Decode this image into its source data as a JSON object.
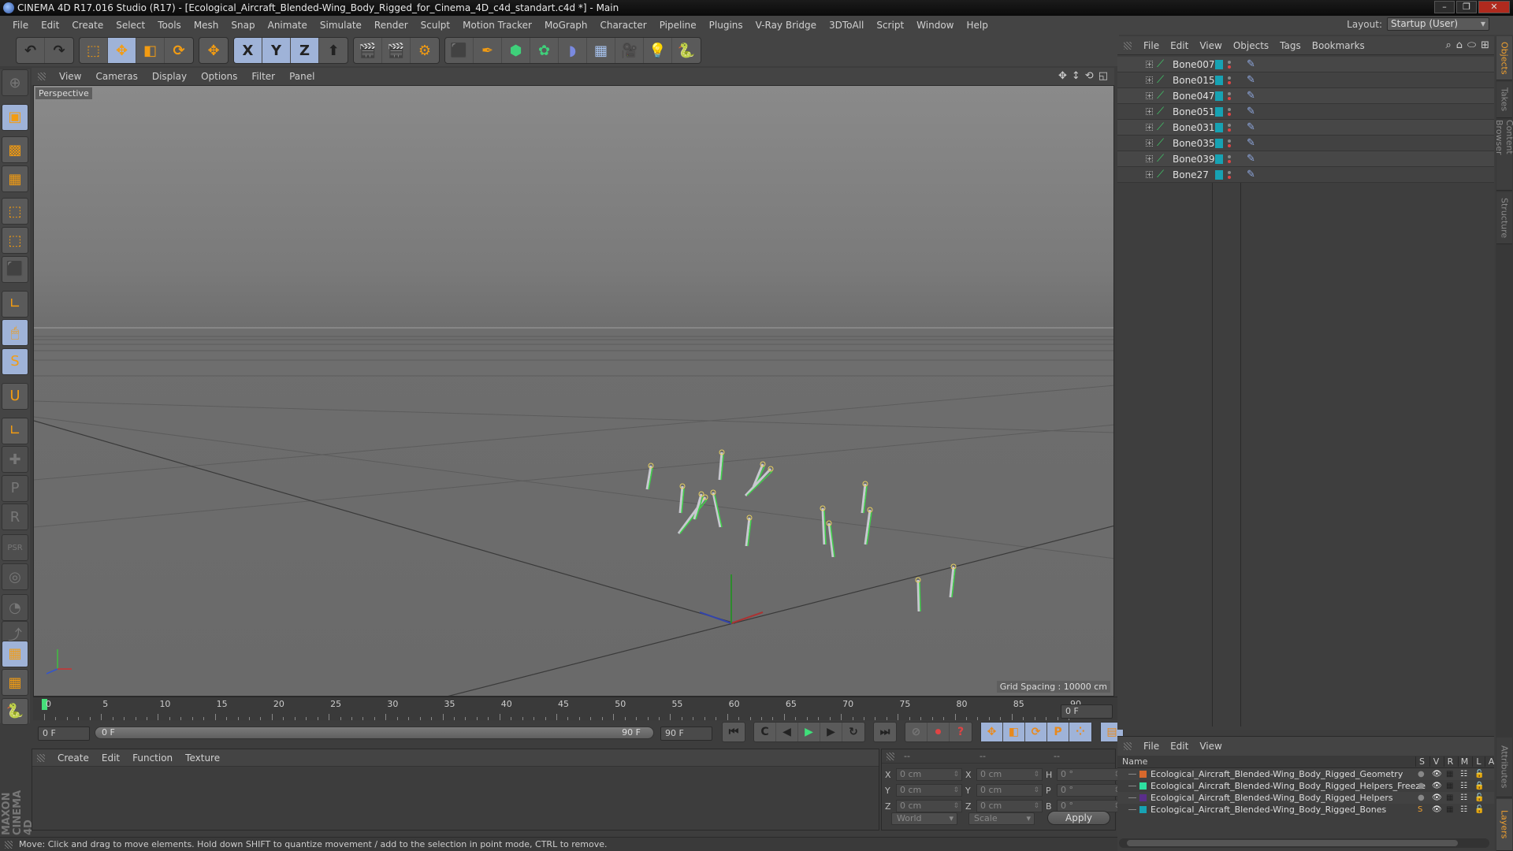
{
  "window": {
    "title": "CINEMA 4D R17.016 Studio (R17) - [Ecological_Aircraft_Blended-Wing_Body_Rigged_for_Cinema_4D_c4d_standart.c4d *] - Main",
    "controls": [
      "minimize",
      "maximize",
      "close"
    ]
  },
  "menubar": {
    "items": [
      "File",
      "Edit",
      "Create",
      "Select",
      "Tools",
      "Mesh",
      "Snap",
      "Animate",
      "Simulate",
      "Render",
      "Sculpt",
      "Motion Tracker",
      "MoGraph",
      "Character",
      "Pipeline",
      "Plugins",
      "V-Ray Bridge",
      "3DToAll",
      "Script",
      "Window",
      "Help"
    ],
    "layout_label": "Layout:",
    "layout_value": "Startup (User)"
  },
  "toolbar": {
    "groups": [
      {
        "name": "history",
        "tools": [
          {
            "id": "undo",
            "icon": "undo-icon",
            "glyph": "↶"
          },
          {
            "id": "redo",
            "icon": "redo-icon",
            "glyph": "↷"
          }
        ]
      },
      {
        "name": "transform",
        "tools": [
          {
            "id": "live-selection",
            "icon": "selection-icon",
            "glyph": "⬚"
          },
          {
            "id": "move",
            "icon": "move-icon",
            "glyph": "✥",
            "active": true
          },
          {
            "id": "scale",
            "icon": "scale-icon",
            "glyph": "◧"
          },
          {
            "id": "rotate",
            "icon": "rotate-icon",
            "glyph": "⟳"
          }
        ]
      },
      {
        "name": "recent",
        "tools": [
          {
            "id": "recent-tool",
            "icon": "move-icon",
            "glyph": "✥"
          }
        ]
      },
      {
        "name": "axis",
        "tools": [
          {
            "id": "x-axis",
            "icon": "x-axis-icon",
            "glyph": "X",
            "active": true
          },
          {
            "id": "y-axis",
            "icon": "y-axis-icon",
            "glyph": "Y",
            "active": true
          },
          {
            "id": "z-axis",
            "icon": "z-axis-icon",
            "glyph": "Z",
            "active": true
          },
          {
            "id": "coord-system",
            "icon": "coordinate-system-icon",
            "glyph": "⬆"
          }
        ]
      },
      {
        "name": "render",
        "tools": [
          {
            "id": "render-view",
            "icon": "render-view-icon",
            "glyph": "🎬"
          },
          {
            "id": "render-picture-viewer",
            "icon": "render-picture-viewer-icon",
            "glyph": "🎬"
          },
          {
            "id": "render-settings",
            "icon": "render-settings-icon",
            "glyph": "⚙"
          }
        ]
      },
      {
        "name": "create",
        "tools": [
          {
            "id": "cube",
            "icon": "cube-icon",
            "glyph": "⬛"
          },
          {
            "id": "pen",
            "icon": "pen-spline-icon",
            "glyph": "✒"
          },
          {
            "id": "subdivision",
            "icon": "subdivision-surface-icon",
            "glyph": "⬢"
          },
          {
            "id": "cloner",
            "icon": "cloner-icon",
            "glyph": "✿"
          },
          {
            "id": "deformer",
            "icon": "bend-deformer-icon",
            "glyph": "◗"
          },
          {
            "id": "floor",
            "icon": "floor-icon",
            "glyph": "▦"
          },
          {
            "id": "camera",
            "icon": "camera-icon",
            "glyph": "🎥"
          },
          {
            "id": "light",
            "icon": "light-icon",
            "glyph": "💡"
          },
          {
            "id": "python",
            "icon": "python-icon",
            "glyph": "🐍"
          }
        ]
      }
    ]
  },
  "leftbar": {
    "tools": [
      {
        "id": "make-editable",
        "icon": "make-editable-icon",
        "glyph": "⊕",
        "state": "dim"
      },
      {
        "id": "model-mode",
        "icon": "model-mode-icon",
        "glyph": "▣",
        "state": "on"
      },
      {
        "id": "texture-mode",
        "icon": "texture-mode-icon",
        "glyph": "▩"
      },
      {
        "id": "workplane-mode",
        "icon": "workplane-icon",
        "glyph": "▦"
      },
      {
        "id": "points-mode",
        "icon": "points-mode-icon",
        "glyph": "⬚"
      },
      {
        "id": "edges-mode",
        "icon": "edges-mode-icon",
        "glyph": "⬚"
      },
      {
        "id": "polygons-mode",
        "icon": "polygons-mode-icon",
        "glyph": "⬛"
      },
      {
        "id": "axis-mode",
        "icon": "axis-mode-icon",
        "glyph": "∟"
      },
      {
        "id": "tweak-mode",
        "icon": "tweak-mode-icon",
        "glyph": "🖱",
        "state": "on"
      },
      {
        "id": "solo-mode",
        "icon": "solo-icon",
        "glyph": "S",
        "state": "on"
      },
      {
        "id": "snap",
        "icon": "magnet-icon",
        "glyph": "U"
      },
      {
        "id": "axis-lock",
        "icon": "axis-lock-icon",
        "glyph": "∟"
      },
      {
        "id": "ik-add",
        "icon": "ik-add-icon",
        "glyph": "✚",
        "state": "dim"
      },
      {
        "id": "ik-p",
        "icon": "ik-position-icon",
        "glyph": "P",
        "state": "dim"
      },
      {
        "id": "ik-r",
        "icon": "ik-rotation-icon",
        "glyph": "R",
        "state": "dim"
      },
      {
        "id": "ik-psr",
        "icon": "ik-psr-icon",
        "glyph": "PSR",
        "state": "dim"
      },
      {
        "id": "ik-target",
        "icon": "ik-target-icon",
        "glyph": "◎",
        "state": "dim"
      },
      {
        "id": "ik-frame",
        "icon": "ik-frame-icon",
        "glyph": "◔",
        "state": "dim"
      },
      {
        "id": "ik-pose",
        "icon": "ik-pose-icon",
        "glyph": "⤴",
        "state": "dim"
      },
      {
        "id": "workplane-lock",
        "icon": "workplane-lock-icon",
        "glyph": "▦",
        "state": "on"
      },
      {
        "id": "workplane-align",
        "icon": "workplane-align-icon",
        "glyph": "▦"
      },
      {
        "id": "python-script",
        "icon": "python-icon",
        "glyph": "🐍"
      }
    ],
    "brand": "MAXON CINEMA 4D"
  },
  "viewport": {
    "menu": [
      "View",
      "Cameras",
      "Display",
      "Options",
      "Filter",
      "Panel"
    ],
    "label": "Perspective",
    "grid_spacing": "Grid Spacing : 10000 cm",
    "nav_icons": [
      "move-view-icon",
      "dolly-view-icon",
      "rotate-view-icon",
      "maximize-view-icon"
    ]
  },
  "objects_panel": {
    "menu": [
      "File",
      "Edit",
      "View",
      "Objects",
      "Tags",
      "Bookmarks"
    ],
    "icons": [
      "search-icon",
      "home-icon",
      "filter-icon",
      "new-window-icon"
    ],
    "objects": [
      {
        "name": "Bone007"
      },
      {
        "name": "Bone015"
      },
      {
        "name": "Bone047"
      },
      {
        "name": "Bone051"
      },
      {
        "name": "Bone031"
      },
      {
        "name": "Bone035"
      },
      {
        "name": "Bone039"
      },
      {
        "name": "Bone27"
      }
    ],
    "layer_color": "#17a2b3"
  },
  "right_tabs": {
    "top": [
      {
        "label": "Objects",
        "active": true
      },
      {
        "label": "Takes"
      },
      {
        "label": "Content Browser"
      },
      {
        "label": "Structure"
      }
    ],
    "bottom": [
      {
        "label": "Attributes"
      },
      {
        "label": "Layers",
        "active": true
      }
    ]
  },
  "timeline": {
    "ticks": [
      "0",
      "5",
      "10",
      "15",
      "20",
      "25",
      "30",
      "35",
      "40",
      "45",
      "50",
      "55",
      "60",
      "65",
      "70",
      "75",
      "80",
      "85",
      "90"
    ],
    "current_frame": "0 F",
    "start_field": "0 F",
    "scrub_start": "0 F",
    "scrub_end": "90 F",
    "end_field": "90 F",
    "frame_readout": "0 F",
    "min": 0,
    "max": 90,
    "position": 0
  },
  "transport": {
    "nav": [
      {
        "id": "goto-start",
        "icon": "goto-start-icon",
        "glyph": "⏮"
      }
    ],
    "play": [
      {
        "id": "prev-key",
        "icon": "prev-key-icon",
        "glyph": "C"
      },
      {
        "id": "prev-frame",
        "icon": "prev-frame-icon",
        "glyph": "◀"
      },
      {
        "id": "play",
        "icon": "play-icon",
        "glyph": "▶"
      },
      {
        "id": "next-frame",
        "icon": "next-frame-icon",
        "glyph": "▶"
      },
      {
        "id": "next-key",
        "icon": "next-key-icon",
        "glyph": "↻"
      }
    ],
    "end": [
      {
        "id": "goto-end",
        "icon": "goto-end-icon",
        "glyph": "⏭"
      }
    ],
    "keys": [
      {
        "id": "record-path",
        "icon": "keyframe-selection-icon",
        "glyph": "⊘"
      },
      {
        "id": "autokey",
        "icon": "record-icon",
        "glyph": "⏺"
      },
      {
        "id": "key-help",
        "icon": "help-icon",
        "glyph": "?"
      }
    ],
    "track": [
      {
        "id": "key-move",
        "icon": "move-key-icon",
        "glyph": "✥"
      },
      {
        "id": "key-scale",
        "icon": "scale-key-icon",
        "glyph": "◧"
      },
      {
        "id": "key-rotate",
        "icon": "rotate-key-icon",
        "glyph": "⟳"
      },
      {
        "id": "key-param",
        "icon": "param-key-icon",
        "glyph": "P"
      },
      {
        "id": "key-pla",
        "icon": "pla-key-icon",
        "glyph": "⁘"
      }
    ],
    "timeline_btn": [
      {
        "id": "timeline",
        "icon": "film-strip-icon",
        "glyph": "▤"
      }
    ]
  },
  "material_panel": {
    "menu": [
      "Create",
      "Edit",
      "Function",
      "Texture"
    ]
  },
  "coord_panel": {
    "headers": [
      "--",
      "--",
      "--"
    ],
    "rows": [
      {
        "a_label": "X",
        "a_value": "0 cm",
        "b_label": "X",
        "b_value": "0 cm",
        "c_label": "H",
        "c_value": "0 °"
      },
      {
        "a_label": "Y",
        "a_value": "0 cm",
        "b_label": "Y",
        "b_value": "0 cm",
        "c_label": "P",
        "c_value": "0 °"
      },
      {
        "a_label": "Z",
        "a_value": "0 cm",
        "b_label": "Z",
        "b_value": "0 cm",
        "c_label": "B",
        "c_value": "0 °"
      }
    ],
    "space_dropdown": "World",
    "mode_dropdown": "Scale",
    "apply_label": "Apply"
  },
  "layers_panel": {
    "menu": [
      "File",
      "Edit",
      "View"
    ],
    "columns": {
      "name": "Name",
      "flags": [
        "S",
        "V",
        "R",
        "M",
        "L",
        "A"
      ]
    },
    "layers": [
      {
        "name": "Ecological_Aircraft_Blended-Wing_Body_Rigged_Geometry",
        "color": "#d9682c",
        "solo": false,
        "locked": false
      },
      {
        "name": "Ecological_Aircraft_Blended-Wing_Body_Rigged_Helpers_Freeze",
        "color": "#2ee0a0",
        "solo": false,
        "locked": true
      },
      {
        "name": "Ecological_Aircraft_Blended-Wing_Body_Rigged_Helpers",
        "color": "#5a2e8a",
        "solo": false,
        "locked": false
      },
      {
        "name": "Ecological_Aircraft_Blended-Wing_Body_Rigged_Bones",
        "color": "#17a2b3",
        "solo": true,
        "locked": false
      }
    ]
  },
  "statusbar": {
    "text": "Move: Click and drag to move elements. Hold down SHIFT to quantize movement / add to the selection in point mode, CTRL to remove."
  }
}
